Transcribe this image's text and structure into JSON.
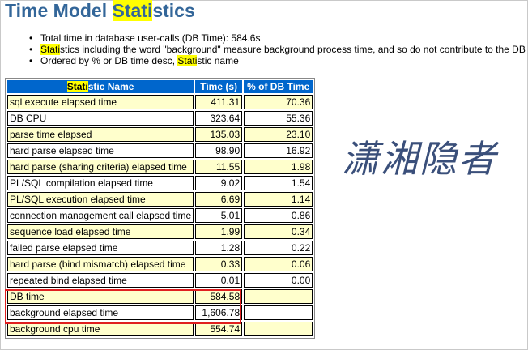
{
  "page": {
    "title_pre": "Time Model ",
    "title_hl": "Stati",
    "title_post": "stics"
  },
  "bullets": [
    {
      "pre": "",
      "hl": "",
      "post": "Total time in database user-calls (DB Time): 584.6s"
    },
    {
      "pre": "",
      "hl": "Stati",
      "post": "stics including the word \"background\" measure background process time, and so do not contribute to the DB tim"
    },
    {
      "pre": "Ordered by % or DB time desc, ",
      "hl": "Stati",
      "post": "stic name"
    }
  ],
  "table": {
    "headers": {
      "name_hl": "Stati",
      "name_post": "stic Name",
      "time": "Time (s)",
      "pct": "% of DB Time"
    },
    "rows": [
      {
        "name": "sql execute elapsed time",
        "time": "411.31",
        "pct": "70.36"
      },
      {
        "name": "DB CPU",
        "time": "323.64",
        "pct": "55.36"
      },
      {
        "name": "parse time elapsed",
        "time": "135.03",
        "pct": "23.10"
      },
      {
        "name": "hard parse elapsed time",
        "time": "98.90",
        "pct": "16.92"
      },
      {
        "name": "hard parse (sharing criteria) elapsed time",
        "time": "11.55",
        "pct": "1.98"
      },
      {
        "name": "PL/SQL compilation elapsed time",
        "time": "9.02",
        "pct": "1.54"
      },
      {
        "name": "PL/SQL execution elapsed time",
        "time": "6.69",
        "pct": "1.14"
      },
      {
        "name": "connection management call elapsed time",
        "time": "5.01",
        "pct": "0.86"
      },
      {
        "name": "sequence load elapsed time",
        "time": "1.99",
        "pct": "0.34"
      },
      {
        "name": "failed parse elapsed time",
        "time": "1.28",
        "pct": "0.22"
      },
      {
        "name": "hard parse (bind mismatch) elapsed time",
        "time": "0.33",
        "pct": "0.06"
      },
      {
        "name": "repeated bind elapsed time",
        "time": "0.01",
        "pct": "0.00"
      },
      {
        "name": "DB time",
        "time": "584.58",
        "pct": ""
      },
      {
        "name": "background elapsed time",
        "time": "1,606.78",
        "pct": ""
      },
      {
        "name": "background cpu time",
        "time": "554.74",
        "pct": ""
      }
    ]
  },
  "watermark": {
    "text": "潇湘隐者"
  },
  "colors": {
    "title": "#336699",
    "highlight": "#ffff00",
    "header_bg": "#0066cc",
    "row_odd": "#ffffcc",
    "annotation_box": "#e02020"
  }
}
